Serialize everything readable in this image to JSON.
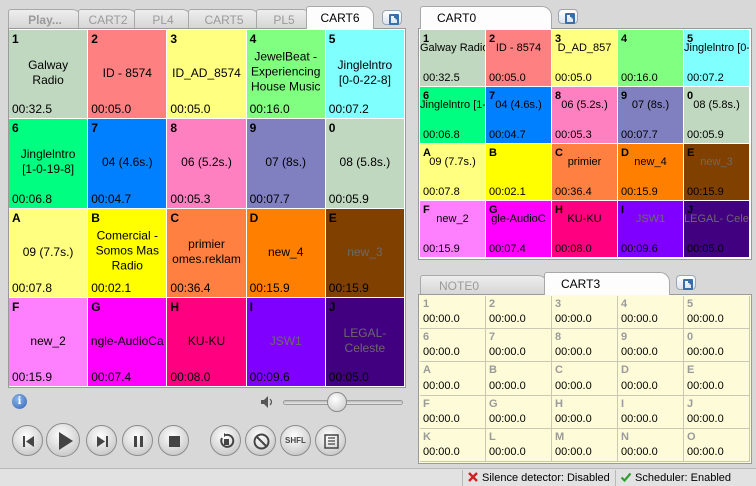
{
  "left_panel": {
    "tabs": [
      {
        "label": "Play...",
        "active": false
      },
      {
        "label": "CART2",
        "active": false
      },
      {
        "label": "PL4",
        "active": false
      },
      {
        "label": "CART5",
        "active": false
      },
      {
        "label": "PL5",
        "active": false
      },
      {
        "label": "CART6",
        "active": true
      }
    ],
    "cells": [
      {
        "key": "1",
        "title": "Galway\nRadio",
        "time": "00:32.5",
        "color": "#c0d8c0"
      },
      {
        "key": "2",
        "title": "ID - 8574",
        "time": "00:05.0",
        "color": "#ff8080"
      },
      {
        "key": "3",
        "title": "ID_AD_8574",
        "time": "00:05.0",
        "color": "#ffff80"
      },
      {
        "key": "4",
        "title": "JewelBeat -\nExperiencing\nHouse Music",
        "time": "00:16.0",
        "color": "#80ff80"
      },
      {
        "key": "5",
        "title": "Jinglelntro\n[0-0-22-8]",
        "time": "00:07.2",
        "color": "#80ffff"
      },
      {
        "key": "6",
        "title": "Jinglelntro\n[1-0-19-8]",
        "time": "00:06.8",
        "color": "#00ff80"
      },
      {
        "key": "7",
        "title": "04 (4.6s.)",
        "time": "00:04.7",
        "color": "#0080ff"
      },
      {
        "key": "8",
        "title": "06 (5.2s.)",
        "time": "00:05.3",
        "color": "#ff80c0"
      },
      {
        "key": "9",
        "title": "07 (8s.)",
        "time": "00:07.7",
        "color": "#8080c0"
      },
      {
        "key": "0",
        "title": "08 (5.8s.)",
        "time": "00:05.9",
        "color": "#c0d8c0"
      },
      {
        "key": "A",
        "title": "09 (7.7s.)",
        "time": "00:07.8",
        "color": "#ffff80"
      },
      {
        "key": "B",
        "title": "Comercial -\nSomos Mas\nRadio",
        "time": "00:02.1",
        "color": "#ffff00"
      },
      {
        "key": "C",
        "title": "primier\nomes.reklam",
        "time": "00:36.4",
        "color": "#ff8040"
      },
      {
        "key": "D",
        "title": "new_4",
        "time": "00:15.9",
        "color": "#ff8000"
      },
      {
        "key": "E",
        "title": "new_3",
        "time": "00:15.9",
        "color": "#804000"
      },
      {
        "key": "F",
        "title": "new_2",
        "time": "00:15.9",
        "color": "#ff80ff"
      },
      {
        "key": "G",
        "title": "ngle-AudioCa",
        "time": "00:07.4",
        "color": "#ff00ff"
      },
      {
        "key": "H",
        "title": "KU-KU",
        "time": "00:08.0",
        "color": "#ff0080"
      },
      {
        "key": "I",
        "title": "JSW1",
        "time": "00:09.6",
        "color": "#8000ff"
      },
      {
        "key": "J",
        "title": "LEGAL-\nCeleste",
        "time": "00:05.0",
        "color": "#400080"
      }
    ]
  },
  "right_top_panel": {
    "tabs": [
      {
        "label": "CART0",
        "active": true
      }
    ],
    "cells": [
      {
        "key": "1",
        "title": "Galway\nRadio",
        "time": "00:32.5",
        "color": "#c0d8c0"
      },
      {
        "key": "2",
        "title": "ID - 8574",
        "time": "00:05.0",
        "color": "#ff8080"
      },
      {
        "key": "3",
        "title": "D_AD_857",
        "time": "00:05.0",
        "color": "#ffff80"
      },
      {
        "key": "4",
        "title": "",
        "time": "00:16.0",
        "color": "#80ff80"
      },
      {
        "key": "5",
        "title": "Jinglelntro\n[0-0-22-8]",
        "time": "00:07.2",
        "color": "#80ffff"
      },
      {
        "key": "6",
        "title": "Jinglelntro\n[1-0-19-8]",
        "time": "00:06.8",
        "color": "#00ff80"
      },
      {
        "key": "7",
        "title": "04 (4.6s.)",
        "time": "00:04.7",
        "color": "#0080ff"
      },
      {
        "key": "8",
        "title": "06 (5.2s.)",
        "time": "00:05.3",
        "color": "#ff80c0"
      },
      {
        "key": "9",
        "title": "07 (8s.)",
        "time": "00:07.7",
        "color": "#8080c0"
      },
      {
        "key": "0",
        "title": "08 (5.8s.)",
        "time": "00:05.9",
        "color": "#c0d8c0"
      },
      {
        "key": "A",
        "title": "09 (7.7s.)",
        "time": "00:07.8",
        "color": "#ffff80"
      },
      {
        "key": "B",
        "title": "",
        "time": "00:02.1",
        "color": "#ffff00"
      },
      {
        "key": "C",
        "title": "primier",
        "time": "00:36.4",
        "color": "#ff8040"
      },
      {
        "key": "D",
        "title": "new_4",
        "time": "00:15.9",
        "color": "#ff8000"
      },
      {
        "key": "E",
        "title": "new_3",
        "time": "00:15.9",
        "color": "#804000"
      },
      {
        "key": "F",
        "title": "new_2",
        "time": "00:15.9",
        "color": "#ff80ff"
      },
      {
        "key": "G",
        "title": "gle-AudioC",
        "time": "00:07.4",
        "color": "#ff00ff"
      },
      {
        "key": "H",
        "title": "KU-KU",
        "time": "00:08.0",
        "color": "#ff0080"
      },
      {
        "key": "I",
        "title": "JSW1",
        "time": "00:09.6",
        "color": "#8000ff"
      },
      {
        "key": "J",
        "title": "LEGAL-\nCeleste",
        "time": "00:05.0",
        "color": "#400080"
      }
    ]
  },
  "right_bottom_panel": {
    "tabs": [
      {
        "label": "NOTE0",
        "active": false
      },
      {
        "label": "CART3",
        "active": true
      }
    ],
    "cells": [
      {
        "key": "1",
        "time": "00:00.0"
      },
      {
        "key": "2",
        "time": "00:00.0"
      },
      {
        "key": "3",
        "time": "00:00.0"
      },
      {
        "key": "4",
        "time": "00:00.0"
      },
      {
        "key": "5",
        "time": "00:00.0"
      },
      {
        "key": "6",
        "time": "00:00.0"
      },
      {
        "key": "7",
        "time": "00:00.0"
      },
      {
        "key": "8",
        "time": "00:00.0"
      },
      {
        "key": "9",
        "time": "00:00.0"
      },
      {
        "key": "0",
        "time": "00:00.0"
      },
      {
        "key": "A",
        "time": "00:00.0"
      },
      {
        "key": "B",
        "time": "00:00.0"
      },
      {
        "key": "C",
        "time": "00:00.0"
      },
      {
        "key": "D",
        "time": "00:00.0"
      },
      {
        "key": "E",
        "time": "00:00.0"
      },
      {
        "key": "F",
        "time": "00:00.0"
      },
      {
        "key": "G",
        "time": "00:00.0"
      },
      {
        "key": "H",
        "time": "00:00.0"
      },
      {
        "key": "I",
        "time": "00:00.0"
      },
      {
        "key": "J",
        "time": "00:00.0"
      },
      {
        "key": "K",
        "time": "00:00.0"
      },
      {
        "key": "L",
        "time": "00:00.0"
      },
      {
        "key": "M",
        "time": "00:00.0"
      },
      {
        "key": "N",
        "time": "00:00.0"
      },
      {
        "key": "O",
        "time": "00:00.0"
      }
    ]
  },
  "player": {
    "info_icon": "info-icon",
    "volume_icon": "speaker-icon",
    "volume_level": 0.45,
    "shuffle_label": "SHFL"
  },
  "status_bar": {
    "silence_detector": "Silence detector: Disabled",
    "scheduler": "Scheduler: Enabled"
  }
}
